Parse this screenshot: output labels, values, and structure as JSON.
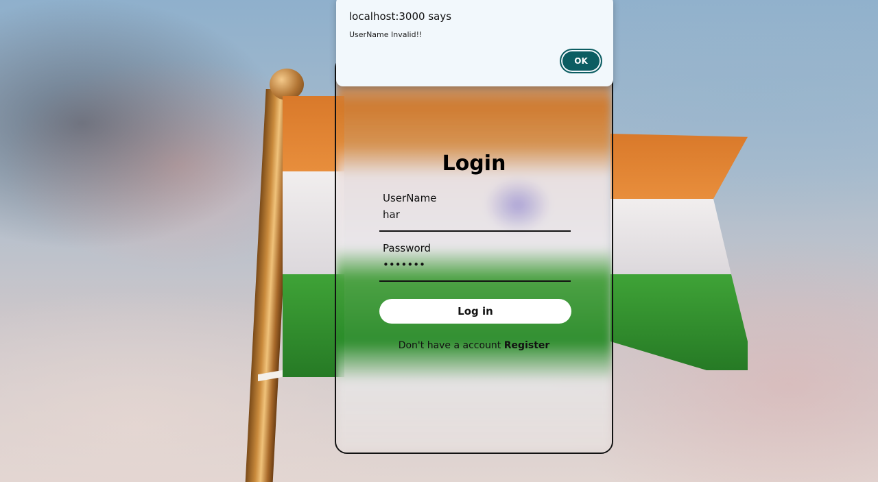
{
  "alert": {
    "title": "localhost:3000 says",
    "message": "UserName Invalid!!",
    "ok_label": "OK"
  },
  "login": {
    "title": "Login",
    "username_label": "UserName",
    "username_value": "har",
    "password_label": "Password",
    "password_value": "•••••••",
    "submit_label": "Log in",
    "register_prompt": "Don't have a account",
    "register_link": "Register"
  },
  "colors": {
    "alert_button": "#0c5d62",
    "alert_bg": "#f2f8fc",
    "saffron": "#e88e3c",
    "green": "#2f8f2c"
  }
}
